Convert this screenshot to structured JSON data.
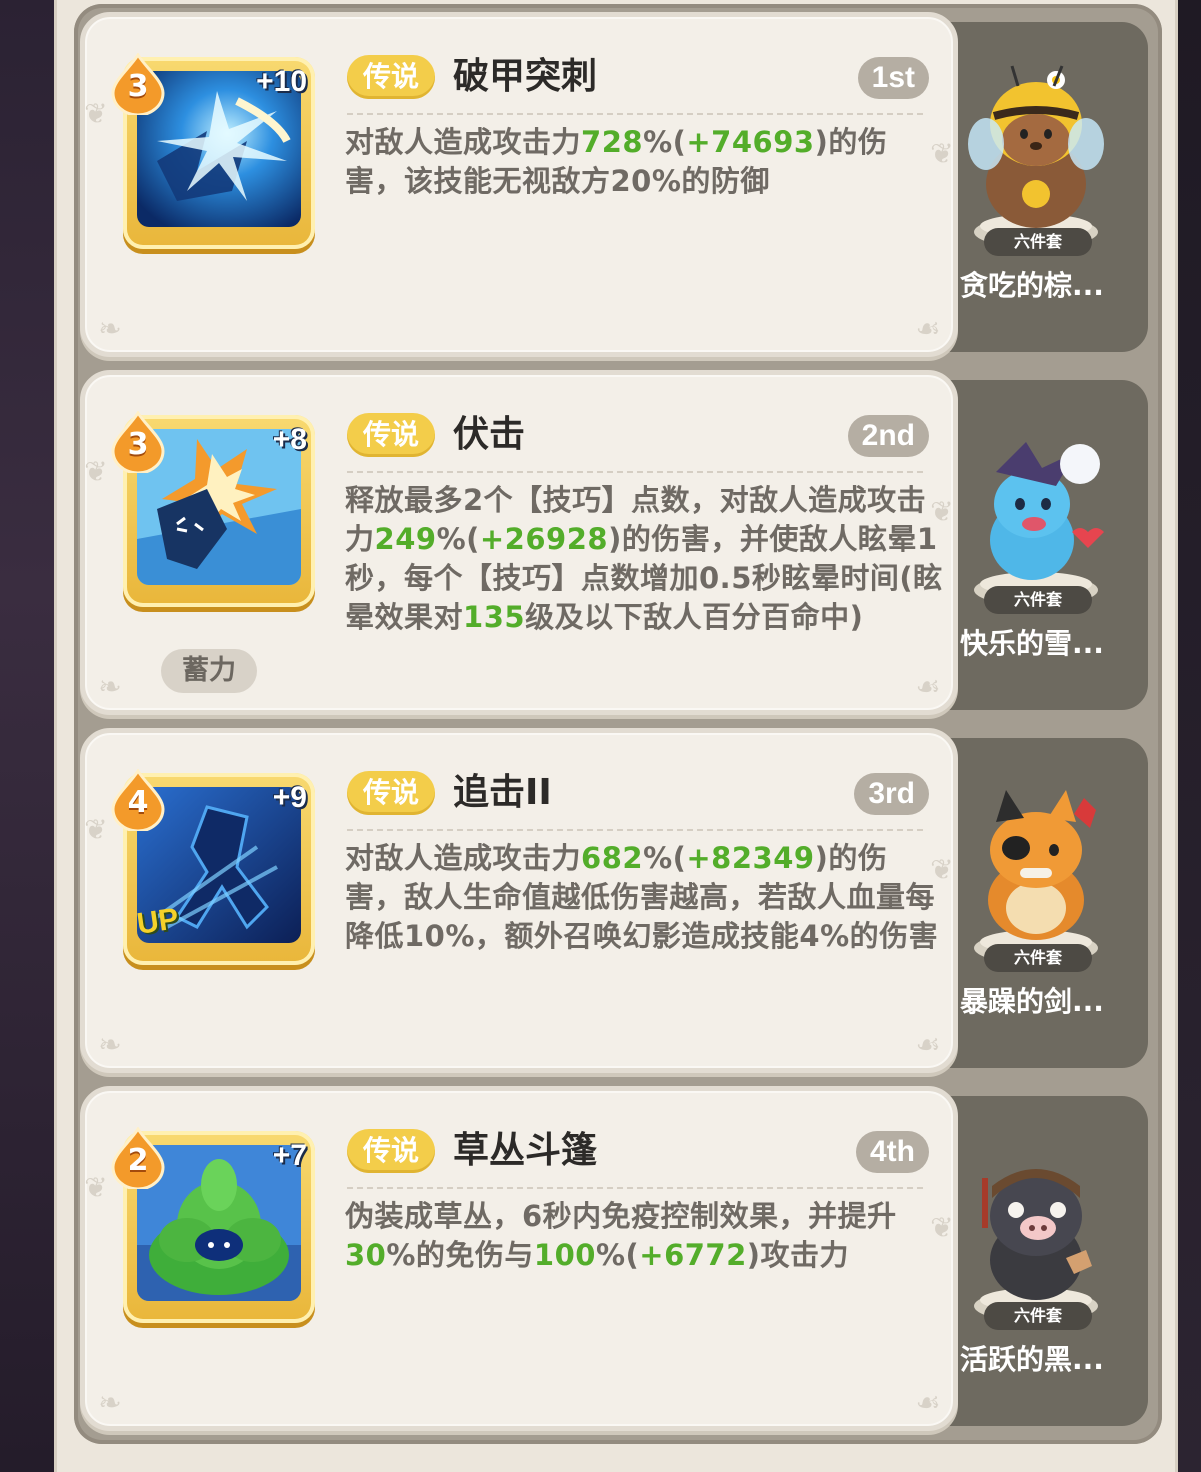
{
  "skills": [
    {
      "level": "3",
      "plus": "+10",
      "rarity": "传说",
      "name": "破甲突刺",
      "rank": "1st",
      "desc": [
        {
          "t": "对敌人造成攻击力",
          "h": false
        },
        {
          "t": "728",
          "h": true
        },
        {
          "t": "%(",
          "h": false
        },
        {
          "t": "+74693",
          "h": true
        },
        {
          "t": ")的伤害，该技能无视敌方20%的防御",
          "h": false
        }
      ],
      "pet": {
        "set": "六件套",
        "name": "贪吃的棕..."
      }
    },
    {
      "level": "3",
      "plus": "+8",
      "rarity": "传说",
      "name": "伏击",
      "rank": "2nd",
      "charge": "蓄力",
      "desc": [
        {
          "t": "释放最多2个【技巧】点数，对敌人造成攻击力",
          "h": false
        },
        {
          "t": "249",
          "h": true
        },
        {
          "t": "%(",
          "h": false
        },
        {
          "t": "+26928",
          "h": true
        },
        {
          "t": ")的伤害，并使敌人眩晕1秒，每个【技巧】点数增加0.5秒眩晕时间(眩晕效果对",
          "h": false
        },
        {
          "t": "135",
          "h": true
        },
        {
          "t": "级及以下敌人百分百命中)",
          "h": false
        }
      ],
      "pet": {
        "set": "六件套",
        "name": "快乐的雪..."
      }
    },
    {
      "level": "4",
      "plus": "+9",
      "up": "UP",
      "rarity": "传说",
      "name": "追击II",
      "rank": "3rd",
      "desc": [
        {
          "t": "对敌人造成攻击力",
          "h": false
        },
        {
          "t": "682",
          "h": true
        },
        {
          "t": "%(",
          "h": false
        },
        {
          "t": "+82349",
          "h": true
        },
        {
          "t": ")的伤害，敌人生命值越低伤害越高，若敌人血量每降低10%，额外召唤幻影造成技能4%的伤害",
          "h": false
        }
      ],
      "pet": {
        "set": "六件套",
        "name": "暴躁的剑..."
      }
    },
    {
      "level": "2",
      "plus": "+7",
      "rarity": "传说",
      "name": "草丛斗篷",
      "rank": "4th",
      "desc": [
        {
          "t": "伪装成草丛，6秒内免疫控制效果，并提升",
          "h": false
        },
        {
          "t": "30",
          "h": true
        },
        {
          "t": "%的免伤与",
          "h": false
        },
        {
          "t": "100",
          "h": true
        },
        {
          "t": "%(",
          "h": false
        },
        {
          "t": "+6772",
          "h": true
        },
        {
          "t": ")攻击力",
          "h": false
        }
      ],
      "pet": {
        "set": "六件套",
        "name": "活跃的黑..."
      }
    }
  ],
  "colors": {
    "highlight": "#53ad2a",
    "rarity": "#f3cd4a",
    "rank": "#b5aea3"
  },
  "icons": [
    "armor-pierce-skill-icon",
    "ambush-skill-icon",
    "pursuit-skill-icon",
    "bush-cloak-skill-icon"
  ]
}
